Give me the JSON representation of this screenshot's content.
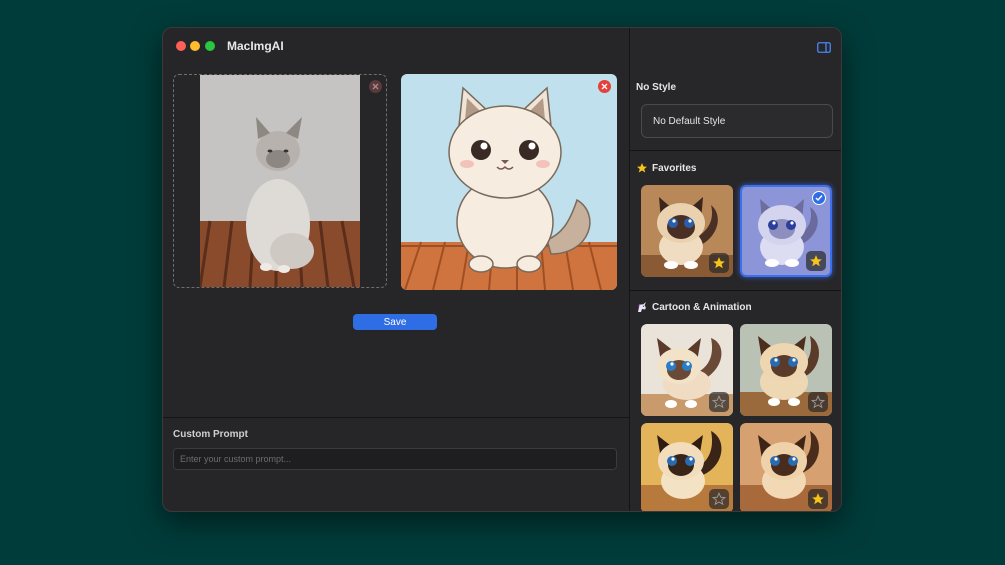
{
  "app": {
    "title": "MacImgAI"
  },
  "main": {
    "save_label": "Save",
    "prompt": {
      "label": "Custom Prompt",
      "placeholder": "Enter your custom prompt...",
      "value": ""
    }
  },
  "sidebar": {
    "no_style_title": "No Style",
    "default_style_label": "No Default Style",
    "favorites_title": "Favorites",
    "cartoon_title": "Cartoon & Animation",
    "favorites": [
      {
        "starred": true,
        "selected": false
      },
      {
        "starred": true,
        "selected": true
      }
    ],
    "cartoon": [
      {
        "starred": false
      },
      {
        "starred": false
      },
      {
        "starred": false
      },
      {
        "starred": true
      }
    ]
  },
  "colors": {
    "accent": "#2f6de5",
    "remove": "#e5403a",
    "star": "#f5c518"
  }
}
